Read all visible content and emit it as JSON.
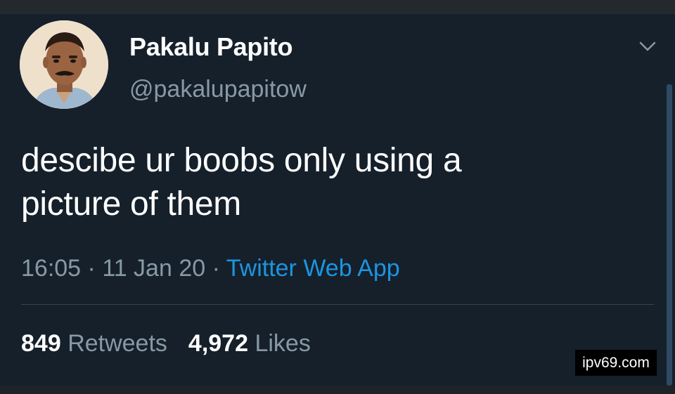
{
  "user": {
    "display_name": "Pakalu Papito",
    "handle": "@pakalupapitow"
  },
  "tweet": {
    "text_line1": "descibe ur boobs only using a",
    "text_line2": "picture of them",
    "time": "16:05",
    "date": "11 Jan 20",
    "separator": " · ",
    "source": "Twitter Web App"
  },
  "stats": {
    "retweets_count": "849",
    "retweets_label": "Retweets",
    "likes_count": "4,972",
    "likes_label": "Likes"
  },
  "watermark": "ipv69.com",
  "icons": {
    "caret": "chevron-down-icon",
    "avatar": "user-avatar"
  },
  "colors": {
    "background": "#15202b",
    "text_primary": "#ffffff",
    "text_secondary": "#8899a6",
    "link": "#1b95e0"
  }
}
